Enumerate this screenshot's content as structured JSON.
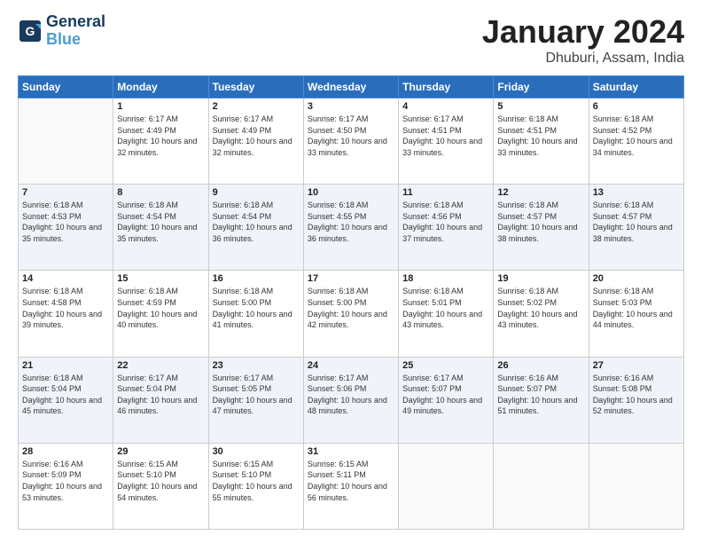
{
  "header": {
    "logo_line1": "General",
    "logo_line2": "Blue",
    "month": "January 2024",
    "location": "Dhuburi, Assam, India"
  },
  "weekdays": [
    "Sunday",
    "Monday",
    "Tuesday",
    "Wednesday",
    "Thursday",
    "Friday",
    "Saturday"
  ],
  "weeks": [
    [
      {
        "day": "",
        "sunrise": "",
        "sunset": "",
        "daylight": ""
      },
      {
        "day": "1",
        "sunrise": "Sunrise: 6:17 AM",
        "sunset": "Sunset: 4:49 PM",
        "daylight": "Daylight: 10 hours and 32 minutes."
      },
      {
        "day": "2",
        "sunrise": "Sunrise: 6:17 AM",
        "sunset": "Sunset: 4:49 PM",
        "daylight": "Daylight: 10 hours and 32 minutes."
      },
      {
        "day": "3",
        "sunrise": "Sunrise: 6:17 AM",
        "sunset": "Sunset: 4:50 PM",
        "daylight": "Daylight: 10 hours and 33 minutes."
      },
      {
        "day": "4",
        "sunrise": "Sunrise: 6:17 AM",
        "sunset": "Sunset: 4:51 PM",
        "daylight": "Daylight: 10 hours and 33 minutes."
      },
      {
        "day": "5",
        "sunrise": "Sunrise: 6:18 AM",
        "sunset": "Sunset: 4:51 PM",
        "daylight": "Daylight: 10 hours and 33 minutes."
      },
      {
        "day": "6",
        "sunrise": "Sunrise: 6:18 AM",
        "sunset": "Sunset: 4:52 PM",
        "daylight": "Daylight: 10 hours and 34 minutes."
      }
    ],
    [
      {
        "day": "7",
        "sunrise": "Sunrise: 6:18 AM",
        "sunset": "Sunset: 4:53 PM",
        "daylight": "Daylight: 10 hours and 35 minutes."
      },
      {
        "day": "8",
        "sunrise": "Sunrise: 6:18 AM",
        "sunset": "Sunset: 4:54 PM",
        "daylight": "Daylight: 10 hours and 35 minutes."
      },
      {
        "day": "9",
        "sunrise": "Sunrise: 6:18 AM",
        "sunset": "Sunset: 4:54 PM",
        "daylight": "Daylight: 10 hours and 36 minutes."
      },
      {
        "day": "10",
        "sunrise": "Sunrise: 6:18 AM",
        "sunset": "Sunset: 4:55 PM",
        "daylight": "Daylight: 10 hours and 36 minutes."
      },
      {
        "day": "11",
        "sunrise": "Sunrise: 6:18 AM",
        "sunset": "Sunset: 4:56 PM",
        "daylight": "Daylight: 10 hours and 37 minutes."
      },
      {
        "day": "12",
        "sunrise": "Sunrise: 6:18 AM",
        "sunset": "Sunset: 4:57 PM",
        "daylight": "Daylight: 10 hours and 38 minutes."
      },
      {
        "day": "13",
        "sunrise": "Sunrise: 6:18 AM",
        "sunset": "Sunset: 4:57 PM",
        "daylight": "Daylight: 10 hours and 38 minutes."
      }
    ],
    [
      {
        "day": "14",
        "sunrise": "Sunrise: 6:18 AM",
        "sunset": "Sunset: 4:58 PM",
        "daylight": "Daylight: 10 hours and 39 minutes."
      },
      {
        "day": "15",
        "sunrise": "Sunrise: 6:18 AM",
        "sunset": "Sunset: 4:59 PM",
        "daylight": "Daylight: 10 hours and 40 minutes."
      },
      {
        "day": "16",
        "sunrise": "Sunrise: 6:18 AM",
        "sunset": "Sunset: 5:00 PM",
        "daylight": "Daylight: 10 hours and 41 minutes."
      },
      {
        "day": "17",
        "sunrise": "Sunrise: 6:18 AM",
        "sunset": "Sunset: 5:00 PM",
        "daylight": "Daylight: 10 hours and 42 minutes."
      },
      {
        "day": "18",
        "sunrise": "Sunrise: 6:18 AM",
        "sunset": "Sunset: 5:01 PM",
        "daylight": "Daylight: 10 hours and 43 minutes."
      },
      {
        "day": "19",
        "sunrise": "Sunrise: 6:18 AM",
        "sunset": "Sunset: 5:02 PM",
        "daylight": "Daylight: 10 hours and 43 minutes."
      },
      {
        "day": "20",
        "sunrise": "Sunrise: 6:18 AM",
        "sunset": "Sunset: 5:03 PM",
        "daylight": "Daylight: 10 hours and 44 minutes."
      }
    ],
    [
      {
        "day": "21",
        "sunrise": "Sunrise: 6:18 AM",
        "sunset": "Sunset: 5:04 PM",
        "daylight": "Daylight: 10 hours and 45 minutes."
      },
      {
        "day": "22",
        "sunrise": "Sunrise: 6:17 AM",
        "sunset": "Sunset: 5:04 PM",
        "daylight": "Daylight: 10 hours and 46 minutes."
      },
      {
        "day": "23",
        "sunrise": "Sunrise: 6:17 AM",
        "sunset": "Sunset: 5:05 PM",
        "daylight": "Daylight: 10 hours and 47 minutes."
      },
      {
        "day": "24",
        "sunrise": "Sunrise: 6:17 AM",
        "sunset": "Sunset: 5:06 PM",
        "daylight": "Daylight: 10 hours and 48 minutes."
      },
      {
        "day": "25",
        "sunrise": "Sunrise: 6:17 AM",
        "sunset": "Sunset: 5:07 PM",
        "daylight": "Daylight: 10 hours and 49 minutes."
      },
      {
        "day": "26",
        "sunrise": "Sunrise: 6:16 AM",
        "sunset": "Sunset: 5:07 PM",
        "daylight": "Daylight: 10 hours and 51 minutes."
      },
      {
        "day": "27",
        "sunrise": "Sunrise: 6:16 AM",
        "sunset": "Sunset: 5:08 PM",
        "daylight": "Daylight: 10 hours and 52 minutes."
      }
    ],
    [
      {
        "day": "28",
        "sunrise": "Sunrise: 6:16 AM",
        "sunset": "Sunset: 5:09 PM",
        "daylight": "Daylight: 10 hours and 53 minutes."
      },
      {
        "day": "29",
        "sunrise": "Sunrise: 6:15 AM",
        "sunset": "Sunset: 5:10 PM",
        "daylight": "Daylight: 10 hours and 54 minutes."
      },
      {
        "day": "30",
        "sunrise": "Sunrise: 6:15 AM",
        "sunset": "Sunset: 5:10 PM",
        "daylight": "Daylight: 10 hours and 55 minutes."
      },
      {
        "day": "31",
        "sunrise": "Sunrise: 6:15 AM",
        "sunset": "Sunset: 5:11 PM",
        "daylight": "Daylight: 10 hours and 56 minutes."
      },
      {
        "day": "",
        "sunrise": "",
        "sunset": "",
        "daylight": ""
      },
      {
        "day": "",
        "sunrise": "",
        "sunset": "",
        "daylight": ""
      },
      {
        "day": "",
        "sunrise": "",
        "sunset": "",
        "daylight": ""
      }
    ]
  ]
}
